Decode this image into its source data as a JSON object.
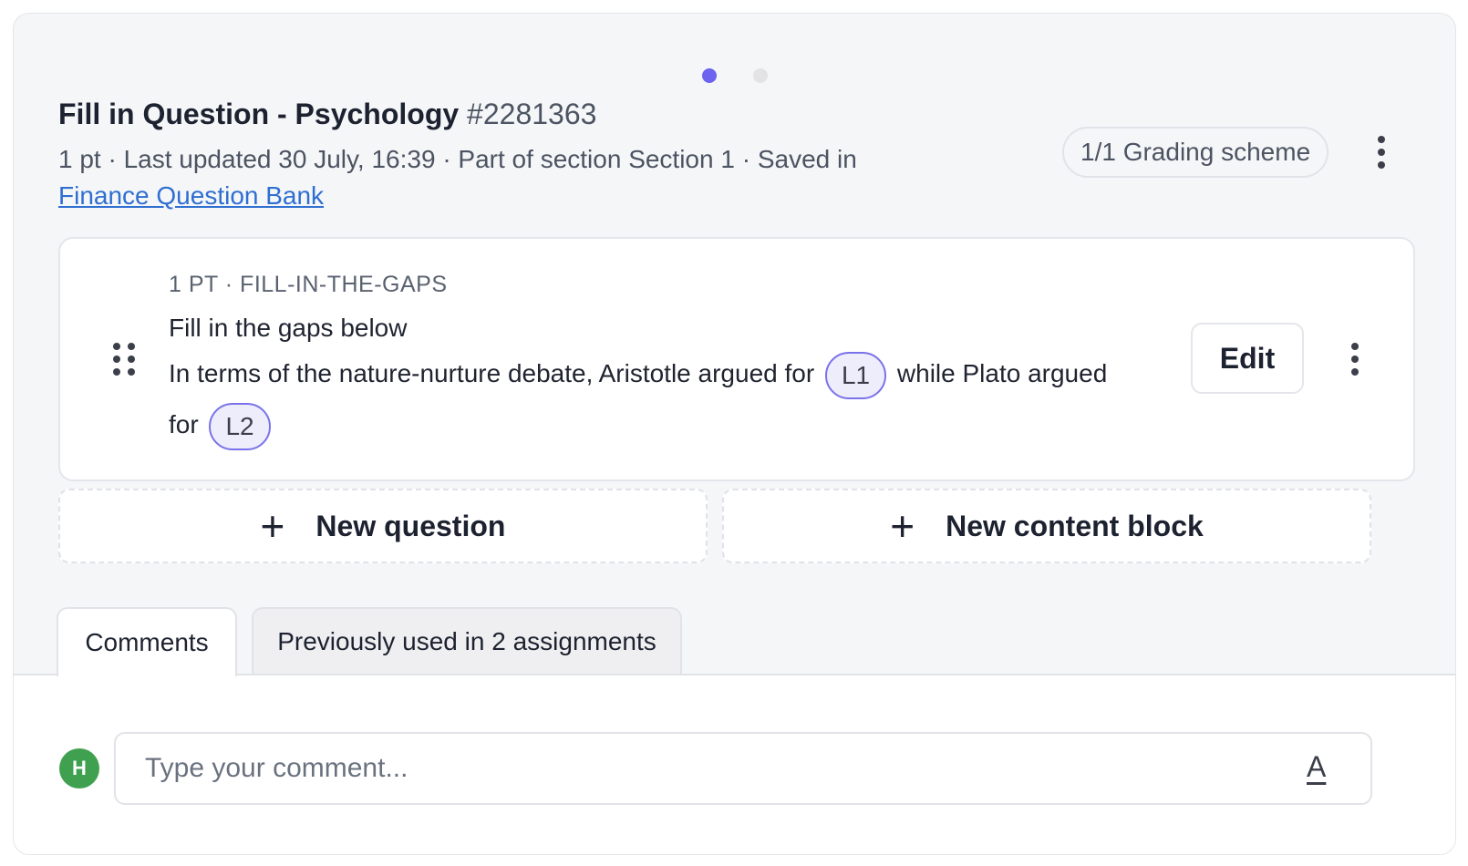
{
  "carousel": {
    "count": 2,
    "active_index": 0
  },
  "question": {
    "title": "Fill in Question - Psychology",
    "id": "#2281363",
    "meta_text": "1 pt · Last updated 30 July, 16:39 · Part of section Section 1 · Saved in",
    "bank_link": "Finance Question Bank",
    "grading_scheme": "1/1 Grading scheme"
  },
  "card": {
    "kind": "1 PT · FILL-IN-THE-GAPS",
    "instruction": "Fill in the gaps below",
    "body_part1": "In terms of the nature-nurture debate, Aristotle argued for",
    "gap1": "L1",
    "body_part2": "while Plato argued for",
    "gap2": "L2",
    "edit_label": "Edit"
  },
  "actions": {
    "new_question": "New question",
    "new_content_block": "New content block"
  },
  "tabs": [
    {
      "label": "Comments",
      "active": true
    },
    {
      "label": "Previously used in 2 assignments",
      "active": false
    }
  ],
  "comment": {
    "avatar_initial": "H",
    "placeholder": "Type your comment...",
    "format_icon": "A"
  },
  "colors": {
    "accent": "#6c63ef",
    "gap_fill": "#eeedfc",
    "avatar": "#3fa14f",
    "link": "#2f6fd1"
  }
}
